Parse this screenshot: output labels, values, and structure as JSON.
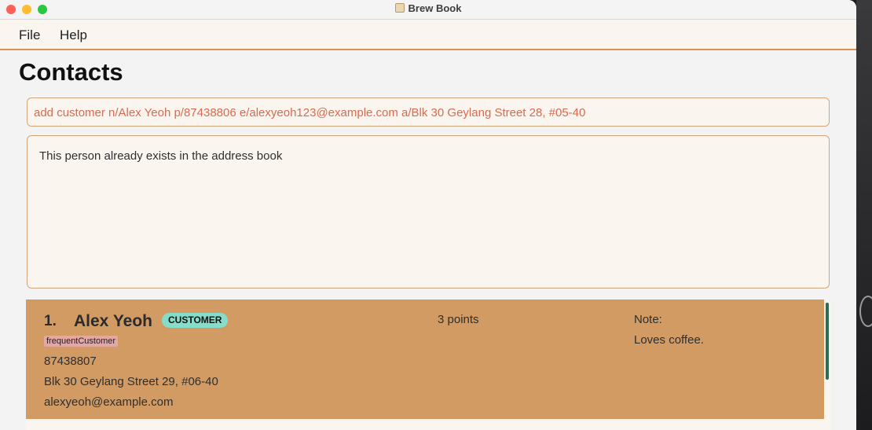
{
  "window": {
    "title": "Brew Book"
  },
  "menu": {
    "file": "File",
    "help": "Help"
  },
  "page": {
    "title": "Contacts"
  },
  "command": {
    "value": "add customer n/Alex Yeoh p/87438806 e/alexyeoh123@example.com a/Blk 30 Geylang Street 28, #05-40"
  },
  "result": {
    "message": "This person already exists in the address book"
  },
  "contacts": [
    {
      "index": "1.",
      "name": "Alex Yeoh",
      "role": "CUSTOMER",
      "tag": "frequentCustomer",
      "phone": "87438807",
      "address": "Blk 30 Geylang Street 29, #06-40",
      "email": "alexyeoh@example.com",
      "points": "3 points",
      "note_label": "Note:",
      "note": "Loves coffee."
    }
  ],
  "colors": {
    "accent": "#d7925a",
    "card": "#d19b63",
    "command_text": "#d96a4f",
    "role_badge": "#86ddc9",
    "tag": "#e4a7a5"
  }
}
